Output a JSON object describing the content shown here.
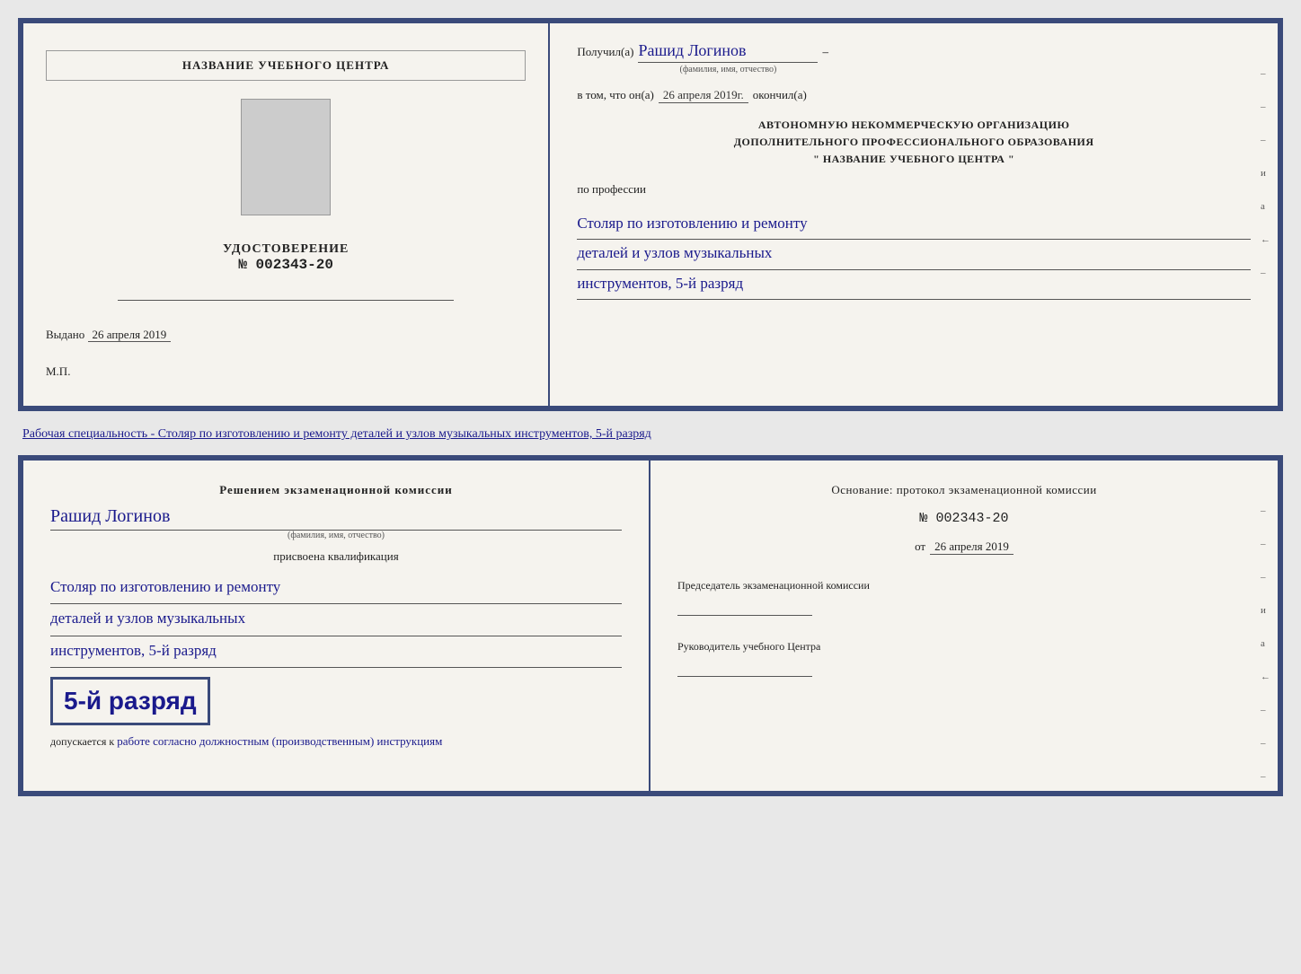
{
  "doc1": {
    "left": {
      "title": "НАЗВАНИЕ УЧЕБНОГО ЦЕНТРА",
      "photo_alt": "photo",
      "udostoverenie_label": "УДОСТОВЕРЕНИЕ",
      "number_prefix": "№",
      "number": "002343-20",
      "vydano_label": "Выдано",
      "vydano_date": "26 апреля 2019",
      "mp_label": "М.П."
    },
    "right": {
      "poluchil_label": "Получил(a)",
      "recipient_name": "Рашид Логинов",
      "fio_subtitle": "(фамилия, имя, отчество)",
      "dash": "–",
      "vtom_label": "в том, что он(а)",
      "vtom_date": "26 апреля 2019г.",
      "okonchil_label": "окончил(а)",
      "org_line1": "АВТОНОМНУЮ НЕКОММЕРЧЕСКУЮ ОРГАНИЗАЦИЮ",
      "org_line2": "ДОПОЛНИТЕЛЬНОГО ПРОФЕССИОНАЛЬНОГО ОБРАЗОВАНИЯ",
      "org_line3": "\"   НАЗВАНИЕ УЧЕБНОГО ЦЕНТРА   \"",
      "po_professii_label": "по профессии",
      "profession_line1": "Столяр по изготовлению и ремонту",
      "profession_line2": "деталей и узлов музыкальных",
      "profession_line3": "инструментов, 5-й разряд",
      "edge_marks": [
        "-",
        "-",
        "-",
        "и",
        "а",
        "←",
        "-"
      ]
    }
  },
  "specialty_text": {
    "prefix": "Рабочая специальность - ",
    "value": "Столяр по изготовлению и ремонту деталей и узлов музыкальных инструментов, 5-й разряд"
  },
  "doc2": {
    "left": {
      "resheniyem_label": "Решением экзаменационной комиссии",
      "name_handwritten": "Рашид Логинов",
      "fio_subtitle": "(фамилия, имя, отчество)",
      "prisvoena_label": "присвоена квалификация",
      "qual_line1": "Столяр по изготовлению и ремонту",
      "qual_line2": "деталей и узлов музыкальных",
      "qual_line3": "инструментов, 5-й разряд",
      "big_rank": "5-й разряд",
      "dopusk_prefix": "допускается к",
      "dopusk_text": "работе согласно должностным (производственным) инструкциям"
    },
    "right": {
      "osnovaniye_label": "Основание: протокол экзаменационной комиссии",
      "number_prefix": "№",
      "protocol_number": "002343-20",
      "ot_label": "от",
      "ot_date": "26 апреля 2019",
      "predsedatel_label": "Председатель экзаменационной комиссии",
      "rukovoditel_label": "Руководитель учебного Центра",
      "edge_marks": [
        "-",
        "-",
        "-",
        "и",
        "а",
        "←",
        "-",
        "-",
        "-"
      ]
    }
  }
}
